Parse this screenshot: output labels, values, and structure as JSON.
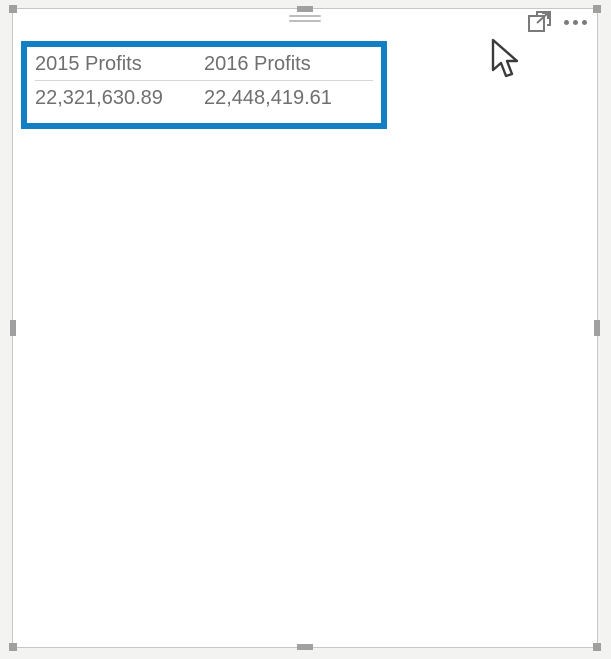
{
  "table": {
    "columns": [
      {
        "header": "2015 Profits",
        "value": "22,321,630.89"
      },
      {
        "header": "2016 Profits",
        "value": "22,448,419.61"
      }
    ]
  },
  "icons": {
    "focus": "focus-mode-icon",
    "more": "more-options-icon",
    "grip": "drag-grip-icon",
    "cursor": "cursor-pointer-icon"
  }
}
